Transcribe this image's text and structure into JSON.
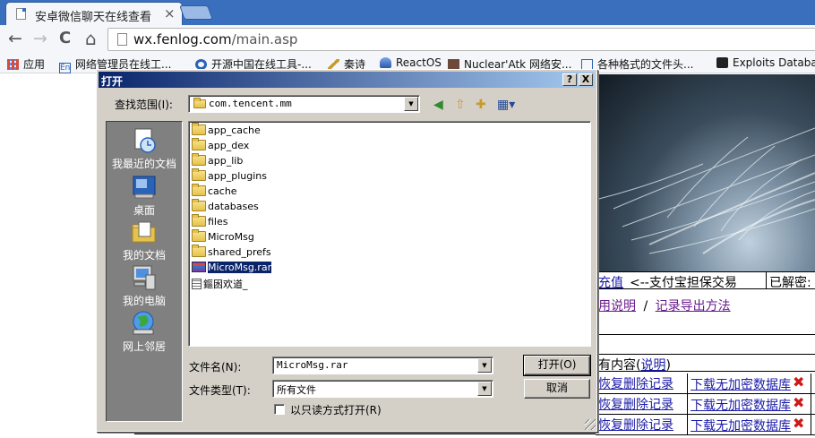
{
  "browser": {
    "tab_title": "安卓微信聊天在线查看",
    "tab_close": "×",
    "nav": {
      "back": "←",
      "forward": "→",
      "reload": "C",
      "home": "⌂"
    },
    "url_host": "wx.fenlog.com",
    "url_path": "/main.asp",
    "bookmarks": [
      "应用",
      "网络管理员在线工...",
      "开源中国在线工具-...",
      "秦诗",
      "ReactOS",
      "Nuclear'Atk 网络安...",
      "各种格式的文件头...",
      "Exploits Database"
    ]
  },
  "page": {
    "recharge": "充值",
    "recharge_note": "<--支付宝担保交易",
    "decrypted": "已解密:",
    "usage": "用说明",
    "slash": "/",
    "export_method": "记录导出方法",
    "content_prefix": "有内容(",
    "content_link": "说明",
    "content_suffix": ")",
    "rows": [
      {
        "restore": "恢复删除记录",
        "download": "下载无加密数据库"
      },
      {
        "restore": "恢复删除记录",
        "download": "下载无加密数据库"
      },
      {
        "restore": "恢复删除记录",
        "download": "下载无加密数据库"
      }
    ],
    "delete_symbol": "✖"
  },
  "dialog": {
    "title": "打开",
    "help_btn": "?",
    "close_btn": "X",
    "look_in_label": "查找范围(I):",
    "look_in_value": "com.tencent.mm",
    "places": [
      "我最近的文档",
      "桌面",
      "我的文档",
      "我的电脑",
      "网上邻居"
    ],
    "files": [
      {
        "name": "app_cache",
        "icon": "folder-icon"
      },
      {
        "name": "app_dex",
        "icon": "folder-icon"
      },
      {
        "name": "app_lib",
        "icon": "folder-icon"
      },
      {
        "name": "app_plugins",
        "icon": "folder-icon"
      },
      {
        "name": "cache",
        "icon": "folder-icon"
      },
      {
        "name": "databases",
        "icon": "folder-icon"
      },
      {
        "name": "files",
        "icon": "folder-icon"
      },
      {
        "name": "MicroMsg",
        "icon": "folder-icon"
      },
      {
        "name": "shared_prefs",
        "icon": "folder-icon"
      },
      {
        "name": "MicroMsg.rar",
        "icon": "rar-archive-icon",
        "selected": true
      },
      {
        "name": "鏂囦欢道_",
        "icon": "file-icon"
      }
    ],
    "filename_label": "文件名(N):",
    "filename_value": "MicroMsg.rar",
    "filetype_label": "文件类型(T):",
    "filetype_value": "所有文件",
    "readonly_label": "以只读方式打开(R)",
    "open_btn": "打开(O)",
    "cancel_btn": "取消"
  },
  "colors": {
    "titlebar_start": "#0a246a",
    "titlebar_end": "#a6caf0",
    "dialog_face": "#d4d0c8",
    "places_bar": "#808080",
    "chrome_frame": "#3a6fbe",
    "link_blue": "#1b1ba8",
    "delete_red": "#d01818"
  }
}
